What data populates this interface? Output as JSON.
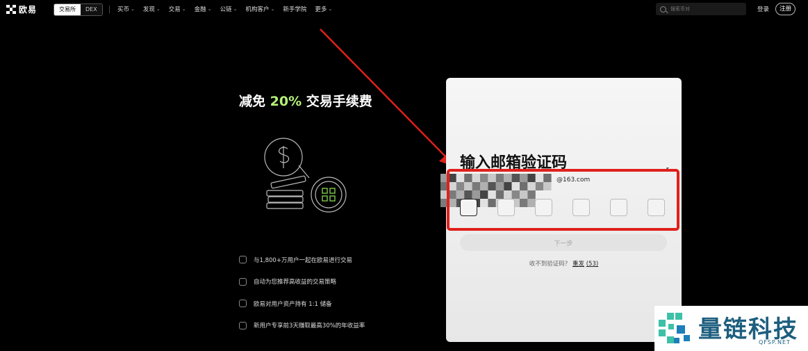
{
  "header": {
    "brand": "欧易",
    "mode_exchange": "交易所",
    "mode_dex": "DEX",
    "nav": [
      {
        "label": "买币",
        "dropdown": true
      },
      {
        "label": "发现",
        "dropdown": true
      },
      {
        "label": "交易",
        "dropdown": true
      },
      {
        "label": "金融",
        "dropdown": true
      },
      {
        "label": "公链",
        "dropdown": true
      },
      {
        "label": "机构客户",
        "dropdown": true
      },
      {
        "label": "新手学院",
        "dropdown": false
      },
      {
        "label": "更多",
        "dropdown": true
      }
    ],
    "search_placeholder": "搜索币对",
    "login": "登录",
    "register": "注册"
  },
  "promo": {
    "title_pre": "减免",
    "title_pct": "20%",
    "title_post": "交易手续费",
    "accent_color": "#b6f278",
    "features": [
      "与1,800+万用户一起在欧易进行交易",
      "自动为您推荐高收益的交易策略",
      "欧易对用户资产持有 1:1 储备",
      "新用户专享前3天赚取最高30%的年收益率"
    ]
  },
  "verify": {
    "title": "输入邮箱验证码",
    "email_suffix": "@163.com",
    "code_length": 6,
    "next_button": "下一步",
    "resend_prompt": "收不到验证码？",
    "resend_link": "重发",
    "resend_countdown": "(53)"
  },
  "watermark": {
    "text": "量链科技",
    "sub": "QFSP.NET",
    "color": "#1d5e7e"
  },
  "annotation_color": "#e0201c"
}
